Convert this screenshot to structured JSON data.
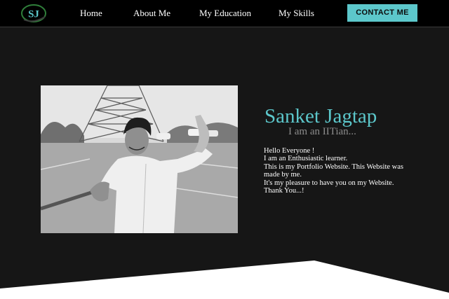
{
  "nav": {
    "logo_text": "SJ",
    "links": [
      "Home",
      "About Me",
      "My Education",
      "My Skills"
    ],
    "contact_label": "CONTACT ME"
  },
  "profile": {
    "photo_icon": "profile-photo",
    "name": "Sanket Jagtap",
    "tagline": "I am an IITian...",
    "bio": [
      "Hello Everyone !",
      "I am an Enthusiastic learner.",
      "This is my Portfolio Website. This Website was made by me.",
      "It's my pleasure to have you on my Website.",
      "Thank You...!"
    ]
  },
  "colors": {
    "accent": "#5cc7cb",
    "background": "#161616",
    "navbar": "#000000",
    "footer_shape": "#ffffff"
  }
}
